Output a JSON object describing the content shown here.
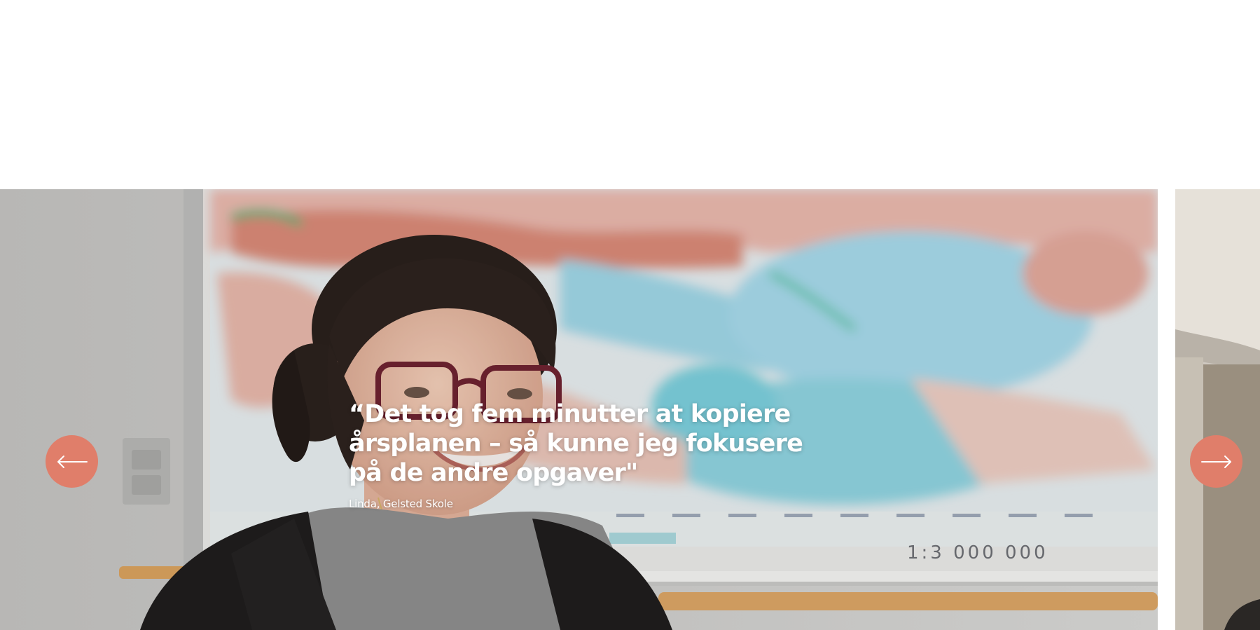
{
  "colors": {
    "accent": "#e07e6a",
    "text_on_image": "#ffffff",
    "page_background": "#ffffff"
  },
  "carousel": {
    "current_slide": {
      "quote": "“Det tog fem minutter at kopiere årsplanen – så kunne jeg fokusere på de andre opgaver\"",
      "attribution": "Linda, Gelsted Skole",
      "map_scale_label": "1:3 000 000"
    },
    "prev_button_icon": "arrow-left-icon",
    "next_button_icon": "arrow-right-icon"
  }
}
